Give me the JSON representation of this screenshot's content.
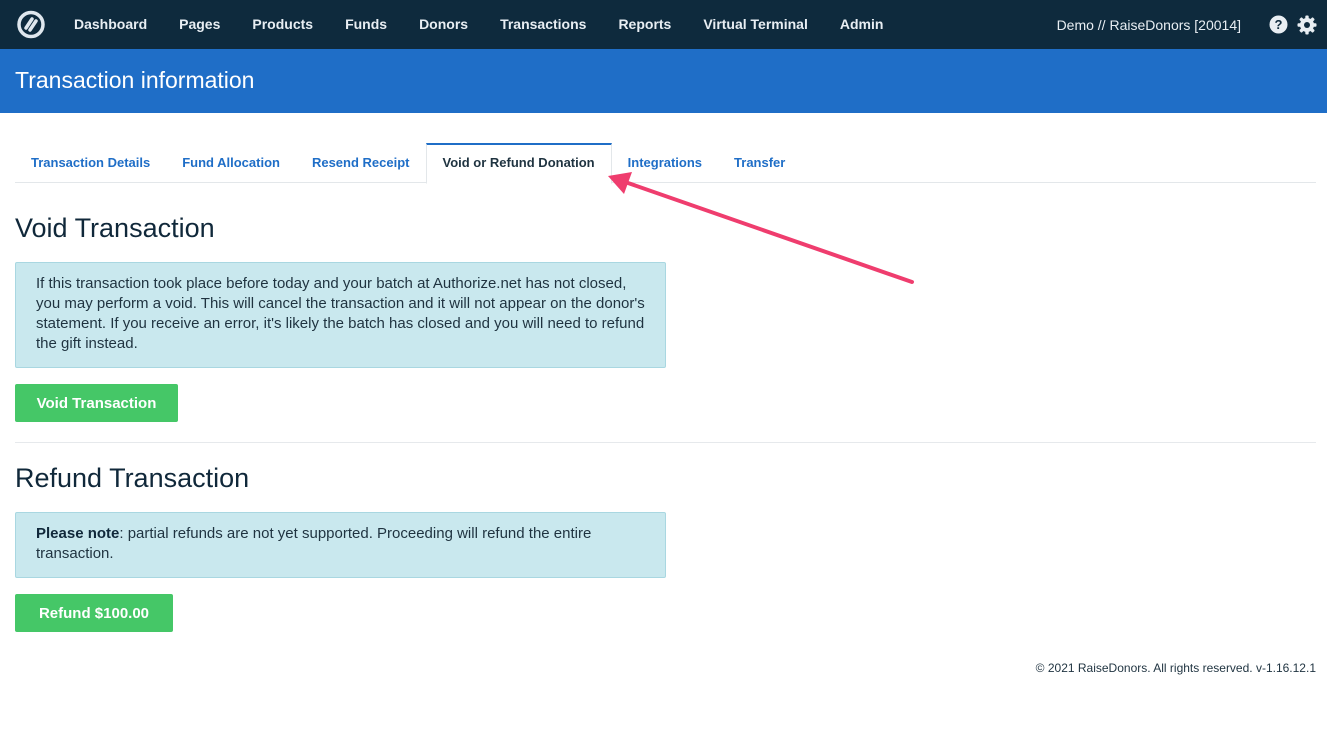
{
  "nav": {
    "items": [
      {
        "label": "Dashboard"
      },
      {
        "label": "Pages"
      },
      {
        "label": "Products"
      },
      {
        "label": "Funds"
      },
      {
        "label": "Donors"
      },
      {
        "label": "Transactions"
      },
      {
        "label": "Reports"
      },
      {
        "label": "Virtual Terminal"
      },
      {
        "label": "Admin"
      }
    ],
    "org": "Demo // RaiseDonors [20014]",
    "icons": [
      "help-icon",
      "gear-icon"
    ]
  },
  "header": {
    "title": "Transaction information"
  },
  "tabs": [
    {
      "label": "Transaction Details"
    },
    {
      "label": "Fund Allocation"
    },
    {
      "label": "Resend Receipt"
    },
    {
      "label": "Void or Refund Donation",
      "active": true
    },
    {
      "label": "Integrations"
    },
    {
      "label": "Transfer"
    }
  ],
  "void": {
    "heading": "Void Transaction",
    "notice": "If this transaction took place before today and your batch at Authorize.net has not closed, you may perform a void. This will cancel the transaction and it will not appear on the donor's statement. If you receive an error, it's likely the batch has closed and you will need to refund the gift instead.",
    "button": "Void Transaction"
  },
  "refund": {
    "heading": "Refund Transaction",
    "notice_bold": "Please note",
    "notice_rest": ": partial refunds are not yet supported. Proceeding will refund the entire transaction.",
    "button": "Refund $100.00"
  },
  "footer": {
    "text": "© 2021 RaiseDonors. All rights reserved. v-1.16.12.1"
  },
  "colors": {
    "nav_bg": "#0e2a3d",
    "header_bg": "#1f6ec7",
    "button_green": "#45c767",
    "alert_bg": "#c9e8ee",
    "annotation_arrow": "#ef3d6e"
  }
}
